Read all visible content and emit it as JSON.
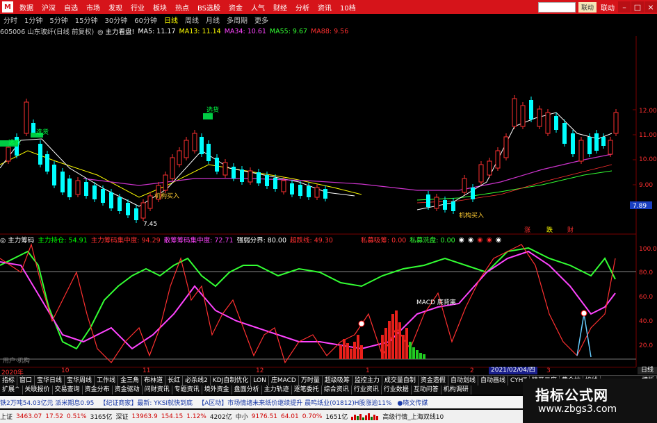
{
  "menu": {
    "logo": "M",
    "items": [
      "数据",
      "沪深",
      "自选",
      "市场",
      "发现",
      "行业",
      "板块",
      "热点",
      "BS选股",
      "资金",
      "人气",
      "财经",
      "分析",
      "资讯",
      "10档"
    ],
    "link_btn": "联动",
    "linkage": "联动"
  },
  "periods": [
    "分时",
    "1分钟",
    "5分钟",
    "15分钟",
    "30分钟",
    "60分钟",
    "日线",
    "周线",
    "月线",
    "多周期",
    "更多"
  ],
  "selected_period": "日线",
  "stock": {
    "title": "605006 山东玻纤(日线 前复权)",
    "view_label": "◎ 主力看盘!",
    "ma": [
      {
        "label": "MA5: 11.17",
        "color": "#ffffff"
      },
      {
        "label": "MA13: 11.14",
        "color": "#ffff00"
      },
      {
        "label": "MA34: 10.61",
        "color": "#ff44ff"
      },
      {
        "label": "MA55: 9.67",
        "color": "#33ff33"
      },
      {
        "label": "MA88: 9.56",
        "color": "#ff3030"
      }
    ]
  },
  "price_axis": {
    "ticks": [
      "12.00",
      "11.00",
      "10.00",
      "9.00"
    ],
    "current": "7.89"
  },
  "annotations": {
    "buy1": "选货",
    "buy2": "选货",
    "buy3": "选货",
    "low_label": "7.45",
    "signal1": "机构买入",
    "signal2": "机构买入",
    "chips": [
      "涨",
      "跌",
      "财"
    ]
  },
  "indicator": {
    "name": "◎ 主力筹码",
    "items": [
      {
        "label": "主力持仓: 54.91",
        "color": "#00ff00"
      },
      {
        "label": "主力筹码集中度: 94.29",
        "color": "#ff3030"
      },
      {
        "label": "散筹筹码集中度: 72.71",
        "color": "#ff44ff"
      },
      {
        "label": "强弱分界: 80.00",
        "color": "#ffffff"
      },
      {
        "label": "超跌线: 49.30",
        "color": "#ff3030"
      },
      {
        "label": "私募吸筹: 0.00",
        "color": "#ff3030"
      },
      {
        "label": "私募洗盘: 0.00",
        "color": "#33ff33"
      }
    ],
    "icons": [
      "◉",
      "◉",
      "◉",
      "◉",
      "◉"
    ],
    "ticks": [
      "100.0",
      "80.0",
      "60.0",
      "40.0",
      "20.0"
    ],
    "macd_label": "MACD 底背离",
    "bottom_label": "用户·机构"
  },
  "x_axis": {
    "labels": [
      "2020年",
      "10",
      "11",
      "12",
      "1",
      "2",
      "3"
    ],
    "cursor_date": "2021/02/04/四",
    "end_label": "日线"
  },
  "tabs_row1": [
    "指标",
    "窗口",
    "宝华日线",
    "宝华周线",
    "工作线",
    "金三角",
    "布林道",
    "长红",
    "必杀线2",
    "KDJ自制优化",
    "LON",
    "庄MACD",
    "万时量",
    "超级吸筹",
    "监控主力",
    "成交量自制",
    "资金造假",
    "自动划线",
    "自动画线",
    "CYHT",
    "精开二度",
    "黄金坑",
    "均线"
  ],
  "tabs_row1_end": "横版",
  "tabs_row2": [
    "扩展^",
    "关联报价",
    "交易查询",
    "资金分布",
    "资金驱动",
    "问财资讯",
    "专题资讯",
    "境外资金",
    "盘面分析",
    "主力轨迹",
    "逐笔委托",
    "综合资讯",
    "行业资讯",
    "行业数据",
    "互动问答",
    "机构调研"
  ],
  "ticker": [
    "铁2万吨54.03亿元 派米期息0.95",
    "【纪证商家】最新: YKSI就快到底",
    "【A区动】市场情绪未来纸价继续提升 晨鸣纸业(01812)H股涨逾11%",
    "●晓文传媒"
  ],
  "status": {
    "sh_name": "上证",
    "sh_value": "3463.07",
    "sh_change": "17.52",
    "sh_pct": "0.51%",
    "sh_amount": "3165亿",
    "sz_name": "深证",
    "sz_value": "13963.9",
    "sz_change": "154.15",
    "sz_pct": "1.12%",
    "sz_amount": "4202亿",
    "zx_name": "中小",
    "zx_value": "9176.51",
    "zx_change": "64.01",
    "zx_pct": "0.70%",
    "zx_amount": "1651亿",
    "quote_msg": "高级行情_上海双线10"
  },
  "watermark": {
    "line1": "指标公式网",
    "line2": "www.zbgs3.com"
  },
  "colors": {
    "up": "#ff3030",
    "down": "#00ffff",
    "menu_bg": "#d6141a",
    "buy": "#00cc44"
  }
}
